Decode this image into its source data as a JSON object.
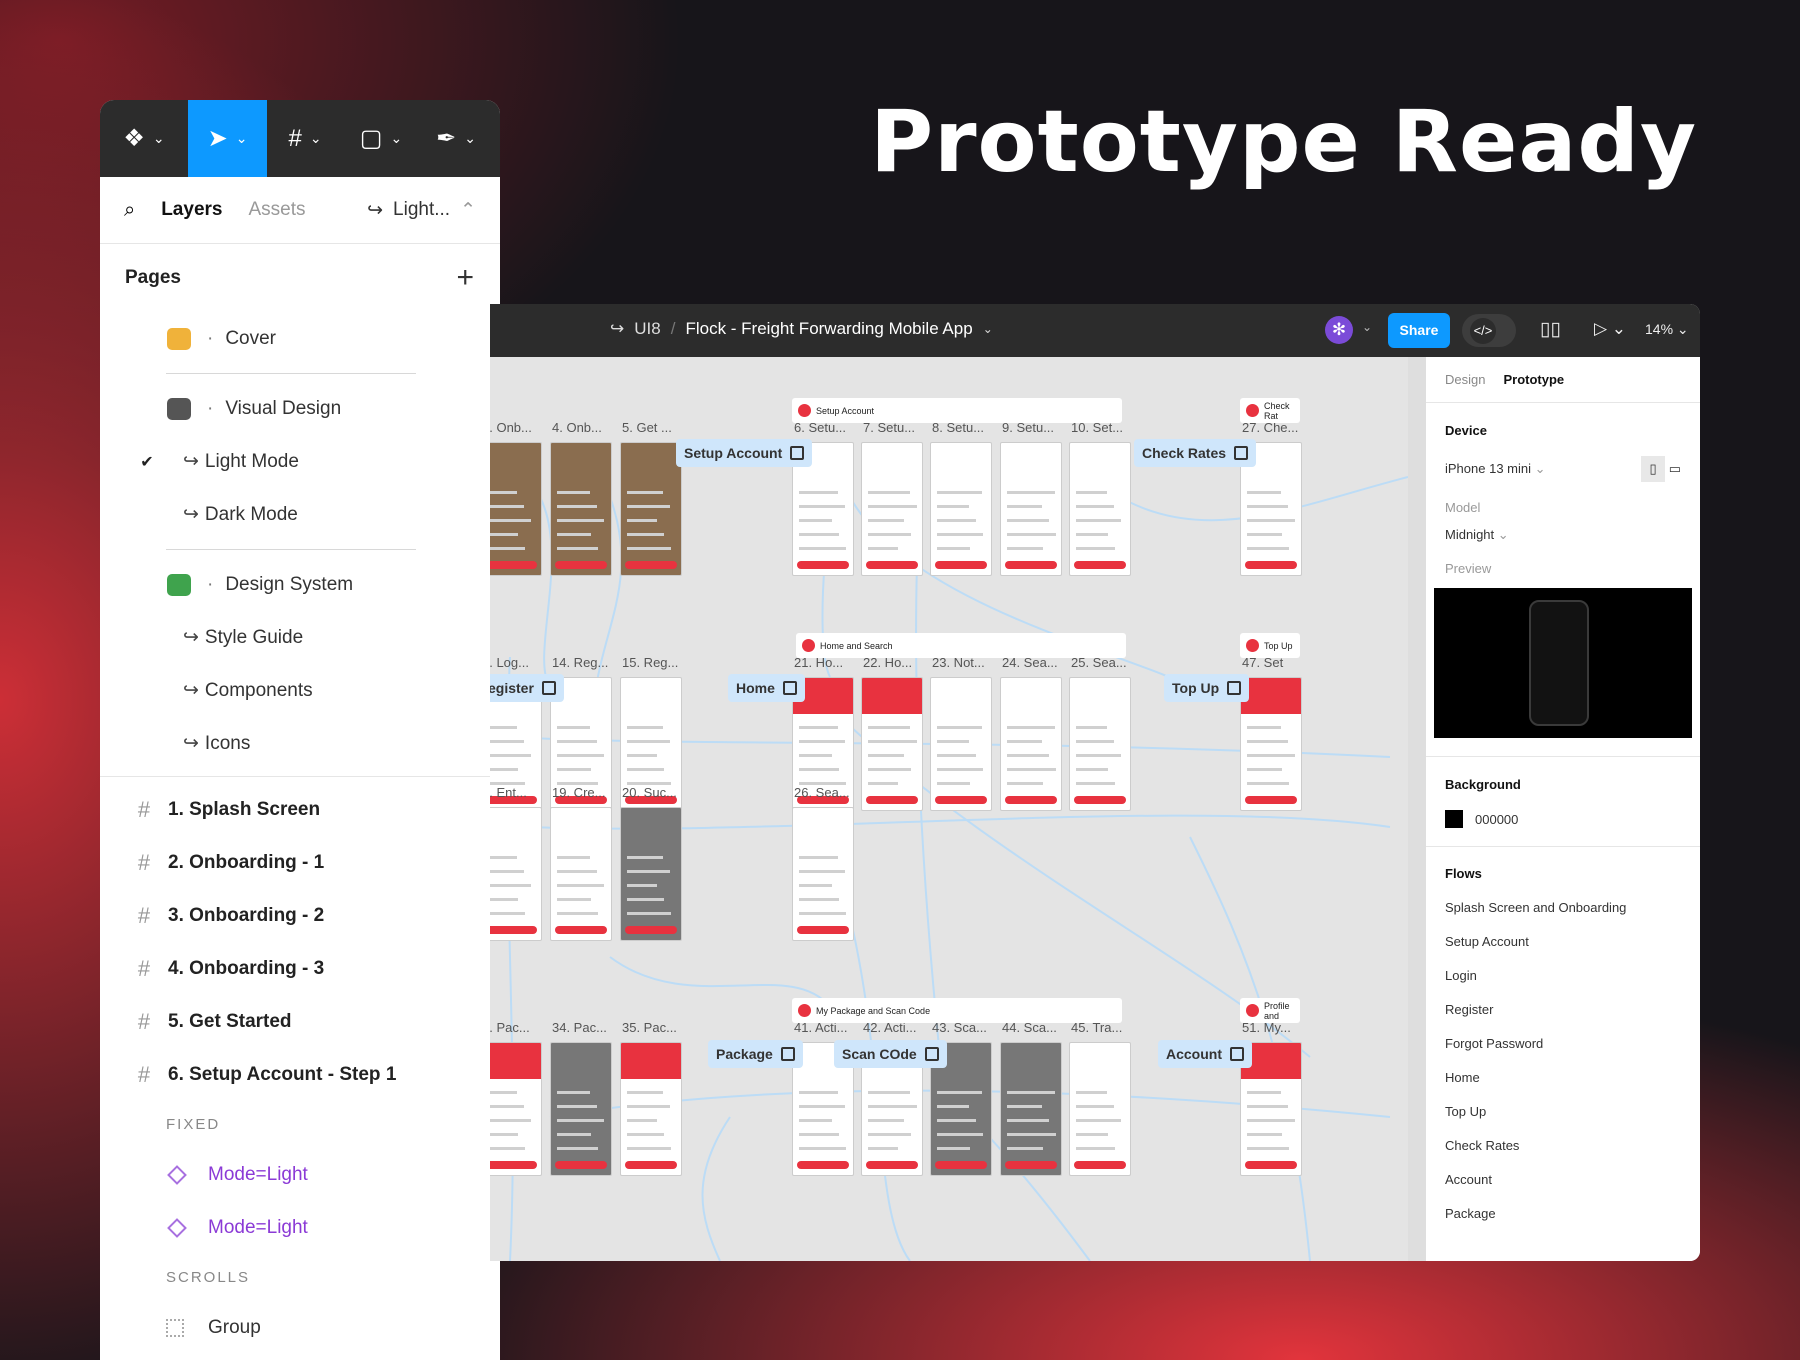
{
  "headline": "Prototype Ready",
  "layers_panel": {
    "tabs": {
      "layers": "Layers",
      "assets": "Assets",
      "page": "Light..."
    },
    "pages_label": "Pages",
    "pages": [
      {
        "name": "Cover",
        "type": "page",
        "icon": "hand-emoji-icon"
      },
      {
        "name": "Visual Design",
        "type": "page",
        "icon": "laptop-emoji-icon"
      },
      {
        "name": "Light Mode",
        "type": "sub",
        "checked": true
      },
      {
        "name": "Dark Mode",
        "type": "sub"
      },
      {
        "name": "Design System",
        "type": "page",
        "icon": "puzzle-emoji-icon"
      },
      {
        "name": "Style Guide",
        "type": "sub"
      },
      {
        "name": "Components",
        "type": "sub"
      },
      {
        "name": "Icons",
        "type": "sub"
      }
    ],
    "layers": [
      "1. Splash Screen",
      "2. Onboarding - 1",
      "3. Onboarding - 2",
      "4. Onboarding - 3",
      "5. Get Started",
      "6. Setup Account - Step 1"
    ],
    "fixed_label": "FIXED",
    "fixed_items": [
      "Mode=Light",
      "Mode=Light"
    ],
    "scrolls_label": "SCROLLS",
    "scroll_items": [
      "Group"
    ]
  },
  "window": {
    "project": "UI8",
    "file": "Flock - Freight Forwarding Mobile App",
    "share": "Share",
    "zoom": "14%",
    "accent": "#0d99ff"
  },
  "canvas": {
    "sections": [
      "Setup Account",
      "Check Rat",
      "Home and Search",
      "Top Up",
      "My Package and Scan Code",
      "Profile and"
    ],
    "flows": [
      "Setup Account",
      "Check Rates",
      "egister",
      "Home",
      "Top Up",
      "Package",
      "Scan COde",
      "Account"
    ],
    "frame_labels": [
      [
        "3. Onb...",
        "4. Onb...",
        "5. Get ...",
        "6. Setu...",
        "7. Setu...",
        "8. Setu...",
        "9. Setu...",
        "10. Set...",
        "27. Che..."
      ],
      [
        "3. Log...",
        "14. Reg...",
        "15. Reg...",
        "21. Ho...",
        "22. Ho...",
        "23. Not...",
        "24. Sea...",
        "25. Sea...",
        "47. Set"
      ],
      [
        "3. Ent...",
        "19. Cre...",
        "20. Suc...",
        "26. Sea..."
      ],
      [
        "3. Pac...",
        "34. Pac...",
        "35. Pac...",
        "41. Acti...",
        "42. Acti...",
        "43. Sca...",
        "44. Sca...",
        "45. Tra...",
        "51. My..."
      ]
    ],
    "brand_color": "#e8323f"
  },
  "design_panel": {
    "tabs": {
      "design": "Design",
      "prototype": "Prototype"
    },
    "device_label": "Device",
    "device": "iPhone 13 mini",
    "model_label": "Model",
    "model": "Midnight",
    "preview_label": "Preview",
    "background_label": "Background",
    "background": "000000",
    "flows_label": "Flows",
    "flows": [
      "Splash Screen and Onboarding",
      "Setup Account",
      "Login",
      "Register",
      "Forgot Password",
      "Home",
      "Top Up",
      "Check Rates",
      "Account",
      "Package"
    ]
  }
}
